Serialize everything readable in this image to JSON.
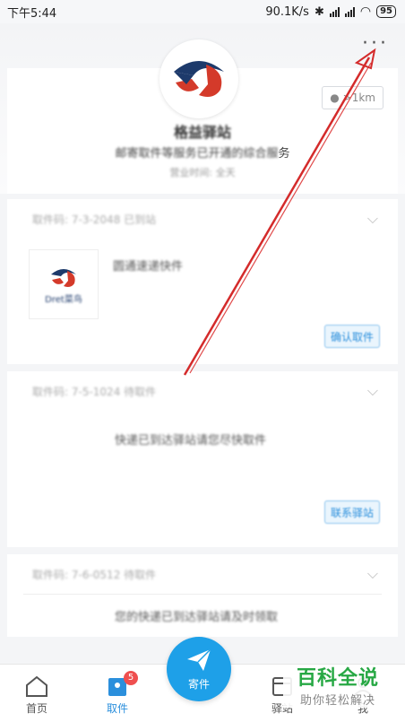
{
  "status_bar": {
    "time": "下午5:44",
    "speed": "90.1K/s",
    "battery": "95"
  },
  "station": {
    "name": "格益驿站",
    "description_blurred": "邮寄取件等服务已开通的综合服",
    "description_end": "务",
    "sub": "营业时间: 全天",
    "distance": ">1km"
  },
  "packages": [
    {
      "header": "取件码: 7-3-2048 已到站",
      "item_text": "圆通速递快件",
      "thumb_label": "Dret菜鸟",
      "action": "确认取件"
    },
    {
      "header": "取件码: 7-5-1024 待取件",
      "item_text": "快递已到达驿站请您尽快取件",
      "action": "联系驿站"
    },
    {
      "header": "取件码: 7-6-0512 待取件",
      "item_text": "您的快递已到达驿站请及时领取"
    }
  ],
  "nav": {
    "home": "首页",
    "pickup": "取件",
    "pickup_badge": "5",
    "send": "寄件",
    "station": "驿站",
    "mine": "我"
  },
  "watermark": {
    "title": "百科全说",
    "subtitle": "助你轻松解决"
  },
  "colors": {
    "accent": "#1ea0e8",
    "badge": "#ef4f4f",
    "arrow": "#d42b2b",
    "watermark": "#27a844"
  }
}
